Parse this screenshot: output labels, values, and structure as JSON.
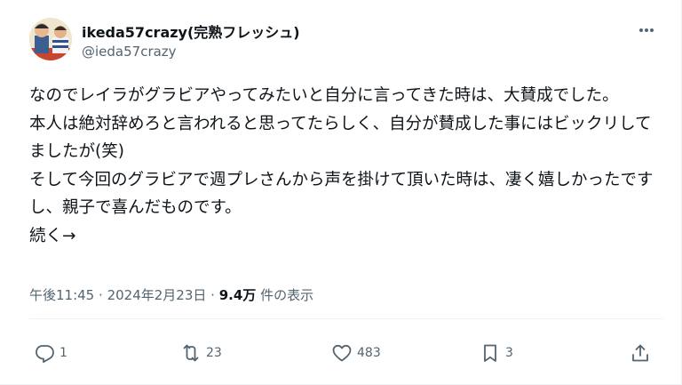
{
  "author": {
    "display_name": "ikeda57crazy(完熟フレッシュ)",
    "handle": "@ieda57crazy"
  },
  "post": {
    "text": "なのでレイラがグラビアやってみたいと自分に言ってきた時は、大賛成でした。\n本人は絶対辞めろと言われると思ってたらしく、自分が賛成した事にはビックリしてましたが(笑)\nそして今回のグラビアで週プレさんから声を掛けて頂いた時は、凄く嬉しかったですし、親子で喜んだものです。\n続く→"
  },
  "meta": {
    "time": "午後11:45",
    "separator": "·",
    "date": "2024年2月23日",
    "views_count": "9.4万",
    "views_label": "件の表示"
  },
  "actions": {
    "reply_count": "1",
    "repost_count": "23",
    "like_count": "483",
    "bookmark_count": "3"
  },
  "icons": [
    "avatar",
    "more-icon",
    "reply-icon",
    "repost-icon",
    "like-icon",
    "bookmark-icon",
    "share-icon"
  ],
  "colors": {
    "text": "#0f1419",
    "secondary": "#536471",
    "divider": "#eff3f4"
  }
}
